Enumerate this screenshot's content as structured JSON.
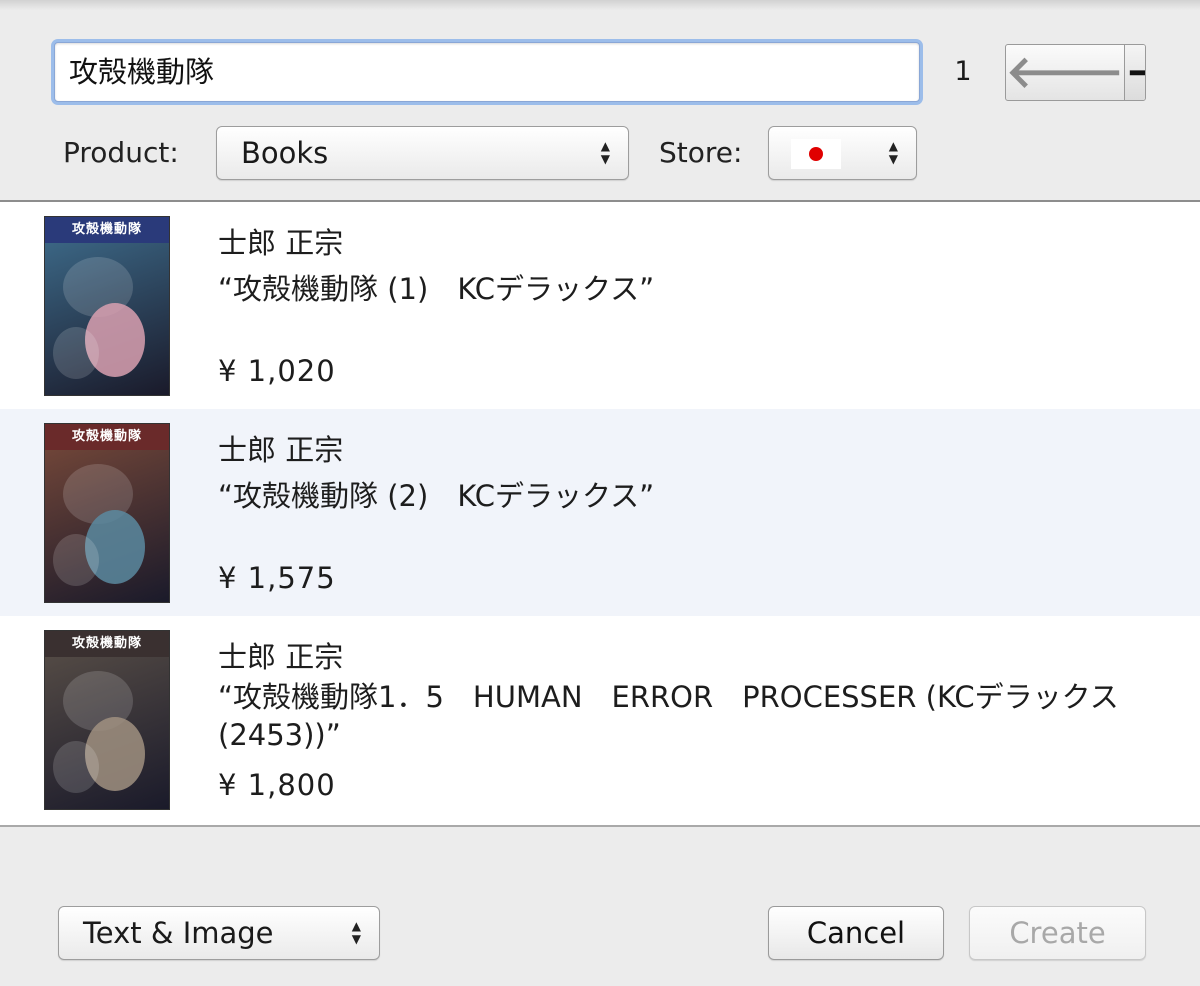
{
  "search": {
    "value": "攻殻機動隊",
    "page_number": "1",
    "back_glyph": "🡐",
    "forward_glyph": "🡒"
  },
  "filters": {
    "product_label": "Product:",
    "product_value": "Books",
    "store_label": "Store:",
    "store_flag": "japan-flag-icon",
    "popup_arrows": [
      "▲",
      "▼"
    ]
  },
  "results": [
    {
      "author": "士郎 正宗",
      "title": "“攻殻機動隊 (1)　KCデラックス”",
      "price": "¥ 1,020",
      "cover_band": "攻殻機動隊",
      "cover_colors": {
        "top": "#2a3a7a",
        "bg": "#3f6f8f",
        "accent": "#d9a0b0"
      }
    },
    {
      "author": "士郎 正宗",
      "title": "“攻殻機動隊 (2)　KCデラックス”",
      "price": "¥ 1,575",
      "cover_band": "攻殻機動隊",
      "cover_colors": {
        "top": "#6a2a2a",
        "bg": "#7a4a3a",
        "accent": "#5a8aa0"
      }
    },
    {
      "author": "士郎 正宗",
      "title": "“攻殻機動隊1．5　HUMAN　ERROR　PROCESSER (KCデラックス (2453))”",
      "price": "¥ 1,800",
      "cover_band": "攻殻機動隊",
      "cover_colors": {
        "top": "#3a3030",
        "bg": "#5a5048",
        "accent": "#a09080"
      }
    }
  ],
  "footer": {
    "display_value": "Text & Image",
    "cancel_label": "Cancel",
    "create_label": "Create"
  }
}
